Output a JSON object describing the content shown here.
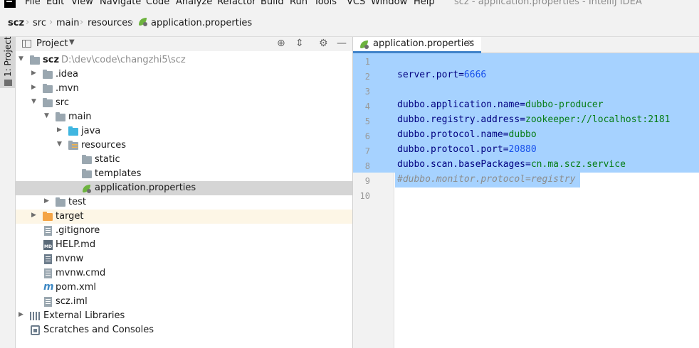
{
  "menu": {
    "items": [
      "File",
      "Edit",
      "View",
      "Navigate",
      "Code",
      "Analyze",
      "Refactor",
      "Build",
      "Run",
      "Tools",
      "VCS",
      "Window",
      "Help"
    ],
    "window_title": "scz - application.properties - IntelliJ IDEA"
  },
  "breadcrumb": [
    "scz",
    "src",
    "main",
    "resources",
    "application.properties"
  ],
  "stripe": {
    "tab_label": "1: Project"
  },
  "project_panel": {
    "title": "Project",
    "tree": [
      {
        "label": "scz",
        "path": "D:\\dev\\code\\changzhi5\\scz"
      },
      {
        "label": ".idea"
      },
      {
        "label": ".mvn"
      },
      {
        "label": "src"
      },
      {
        "label": "main"
      },
      {
        "label": "java"
      },
      {
        "label": "resources"
      },
      {
        "label": "static"
      },
      {
        "label": "templates"
      },
      {
        "label": "application.properties"
      },
      {
        "label": "test"
      },
      {
        "label": "target"
      },
      {
        "label": ".gitignore"
      },
      {
        "label": "HELP.md",
        "icon_text": "MD"
      },
      {
        "label": "mvnw"
      },
      {
        "label": "mvnw.cmd"
      },
      {
        "label": "pom.xml",
        "icon_text": "m"
      },
      {
        "label": "scz.iml"
      },
      {
        "label": "External Libraries"
      },
      {
        "label": "Scratches and Consoles"
      }
    ]
  },
  "editor": {
    "tab_label": "application.properties",
    "line_numbers": [
      "1",
      "2",
      "3",
      "4",
      "5",
      "6",
      "7",
      "8",
      "9",
      "10"
    ],
    "lines": [
      {
        "key": "",
        "sep": "",
        "value": ""
      },
      {
        "key": "server.port",
        "sep": "=",
        "value": "6666"
      },
      {
        "key": "",
        "sep": "",
        "value": ""
      },
      {
        "key": "dubbo.application.name",
        "sep": "=",
        "value": "dubbo-producer"
      },
      {
        "key": "dubbo.registry.address",
        "sep": "=",
        "value": "zookeeper://localhost:2181"
      },
      {
        "key": "dubbo.protocol.name",
        "sep": "=",
        "value": "dubbo"
      },
      {
        "key": "dubbo.protocol.port",
        "sep": "=",
        "value": "20880"
      },
      {
        "key": "dubbo.scan.basePackages",
        "sep": "=",
        "value": "cn.ma.scz.service"
      },
      {
        "comment": "#dubbo.monitor.protocol=registry"
      },
      {
        "key": "",
        "sep": "",
        "value": ""
      }
    ]
  },
  "colors": {
    "selection": "#a6d2ff",
    "property_key": "#000080",
    "property_value": "#067d17",
    "number": "#1750eb",
    "comment": "#8c8c8c",
    "tab_underline": "#4083c9"
  }
}
